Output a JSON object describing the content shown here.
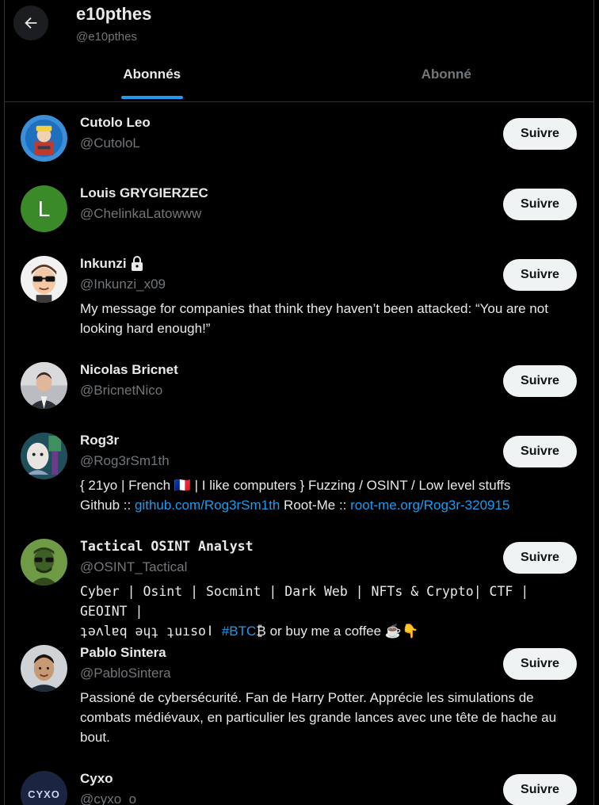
{
  "header": {
    "back_label": "",
    "name": "e10pthes",
    "handle": "@e10pthes"
  },
  "tabs": [
    {
      "label": "Abonnés",
      "active": true
    },
    {
      "label": "Abonné",
      "active": false
    }
  ],
  "accent_color": "#1d9bf0",
  "users": [
    {
      "name": "Cutolo Leo",
      "handle": "@CutoloL",
      "follow_label": "Suivre"
    },
    {
      "name": "Louis GRYGIERZEC",
      "handle": "@ChelinkaLatowww",
      "follow_label": "Suivre",
      "avatar_letter": "L"
    },
    {
      "name": "Inkunzi",
      "handle": "@Inkunzi_x09",
      "follow_label": "Suivre",
      "protected": true,
      "lock_icon": "lock-icon",
      "bio": "My message for companies that think they haven’t been attacked: “You are not looking hard enough!”"
    },
    {
      "name": "Nicolas Bricnet",
      "handle": "@BricnetNico",
      "follow_label": "Suivre"
    },
    {
      "name": "Rog3r",
      "handle": "@Rog3rSm1th",
      "follow_label": "Suivre",
      "bio_line1": "{ 21yo | French 🇫🇷 | I like computers } Fuzzing / OSINT / Low level stuffs",
      "bio_prefix": "Github :: ",
      "bio_link1": "github.com/Rog3rSm1th",
      "bio_mid": " Root-Me :: ",
      "bio_link2": "root-me.org/Rog3r-320915"
    },
    {
      "name": "Tactical OSINT Analyst",
      "handle": "@OSINT_Tactical",
      "follow_label": "Suivre",
      "bio_line1": "Cyber | Osint | Socmint | Dark Web | NFTs & Crypto| CTF | GEOINT |",
      "bio_line2_a": "ʇǝʌlɐq ǝɥʇ ʇuısoǀ ",
      "bio_hashtag": "#BTC",
      "bio_line2_b": "₿  or buy me a coffee ☕👇"
    },
    {
      "name": "Pablo Sintera",
      "handle": "@PabloSintera",
      "follow_label": "Suivre",
      "bio": "Passioné de cybersécurité. Fan de Harry Potter. Apprécie les simulations de combats médiévaux, en particulier les grande lances avec une tête de hache au bout."
    },
    {
      "name": "Cyxo",
      "handle": "@cyxo_o",
      "follow_label": "Suivre",
      "avatar_text": "CYXO"
    }
  ]
}
